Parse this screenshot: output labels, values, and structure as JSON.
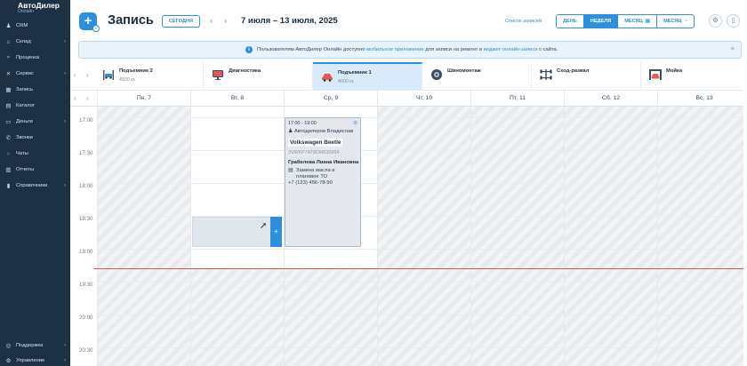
{
  "app": {
    "name": "АвтоДилер",
    "sub": "Онлайн"
  },
  "sidebar": {
    "items": [
      {
        "label": "CRM",
        "icon": "users-icon",
        "chevron": false
      },
      {
        "label": "Склад",
        "icon": "warehouse-icon",
        "chevron": true
      },
      {
        "label": "Проценка",
        "icon": "search-icon",
        "chevron": false
      },
      {
        "label": "Сервис",
        "icon": "wrench-icon",
        "chevron": true
      },
      {
        "label": "Запись",
        "icon": "calendar-icon",
        "chevron": false
      },
      {
        "label": "Каталог",
        "icon": "book-icon",
        "chevron": false
      },
      {
        "label": "Деньги",
        "icon": "wallet-icon",
        "chevron": true
      },
      {
        "label": "Звонки",
        "icon": "phone-icon",
        "chevron": false
      },
      {
        "label": "Чаты",
        "icon": "chat-icon",
        "chevron": false
      },
      {
        "label": "Отчеты",
        "icon": "chart-icon",
        "chevron": false
      },
      {
        "label": "Справочники",
        "icon": "reference-icon",
        "chevron": true
      }
    ],
    "bottom_items": [
      {
        "label": "Поддержка",
        "icon": "help-icon",
        "chevron": true
      },
      {
        "label": "Управление",
        "icon": "settings-icon",
        "chevron": true
      }
    ]
  },
  "header": {
    "add_label": "+",
    "title": "Запись",
    "today_label": "СЕГОДНЯ",
    "prev_label": "‹",
    "next_label": "›",
    "date_range": "7 июля – 13 июля, 2025",
    "list_link": "Список записей",
    "views": [
      {
        "label": "ДЕНЬ",
        "active": false
      },
      {
        "label": "НЕДЕЛЯ",
        "active": true
      },
      {
        "label": "МЕСЯЦ",
        "active": false,
        "icon": "bars-icon"
      },
      {
        "label": "МЕСЯЦ",
        "active": false,
        "icon": "pie-icon"
      }
    ],
    "settings_icon": "⚙",
    "mobile_icon": "▯"
  },
  "banner": {
    "icon": "i",
    "text_1": "Пользователям АвтоДилер Онлайн доступно ",
    "link_1": "мобильное приложение",
    "text_2": " для записи на ремонт и ",
    "link_2": "виджет онлайн-записи",
    "text_3": " с сайта.",
    "close": "×"
  },
  "resources": {
    "prev": "‹",
    "next": "›",
    "items": [
      {
        "name": "Подъемник 2",
        "capacity": "4500 кг.",
        "icon": "lift-icon",
        "active": false
      },
      {
        "name": "Диагностика",
        "capacity": "",
        "icon": "monitor-icon",
        "active": false
      },
      {
        "name": "Подъемник 1",
        "capacity": "4000 кг.",
        "icon": "car-icon",
        "active": true
      },
      {
        "name": "Шиномонтаж",
        "capacity": "",
        "icon": "tire-icon",
        "active": false
      },
      {
        "name": "Сход-развал",
        "capacity": "",
        "icon": "alignment-icon",
        "active": false
      },
      {
        "name": "Мойка",
        "capacity": "",
        "icon": "car-wash-icon",
        "active": false
      }
    ]
  },
  "days": {
    "prev": "‹",
    "next": "›",
    "items": [
      "Пн, 7",
      "Вт, 8",
      "Ср, 9",
      "Чт, 10",
      "Пт, 11",
      "Сб, 12",
      "Вс, 13"
    ]
  },
  "hours": [
    "17:00",
    "17:30",
    "18:00",
    "18:30",
    "19:00",
    "19:30",
    "20:00",
    "20:30"
  ],
  "appointment": {
    "time": "17:00 - 19:00",
    "master": "Автодилеров Владислав",
    "car": "Volkswagen Beetle",
    "vin": "3VWFP7AT8DM630954",
    "client": "Грабелева Лиана Ивановна",
    "work": "Замена масла и плановое ТО",
    "phone": "+7 (123) 456-78-90"
  },
  "slot_add_label": "+"
}
